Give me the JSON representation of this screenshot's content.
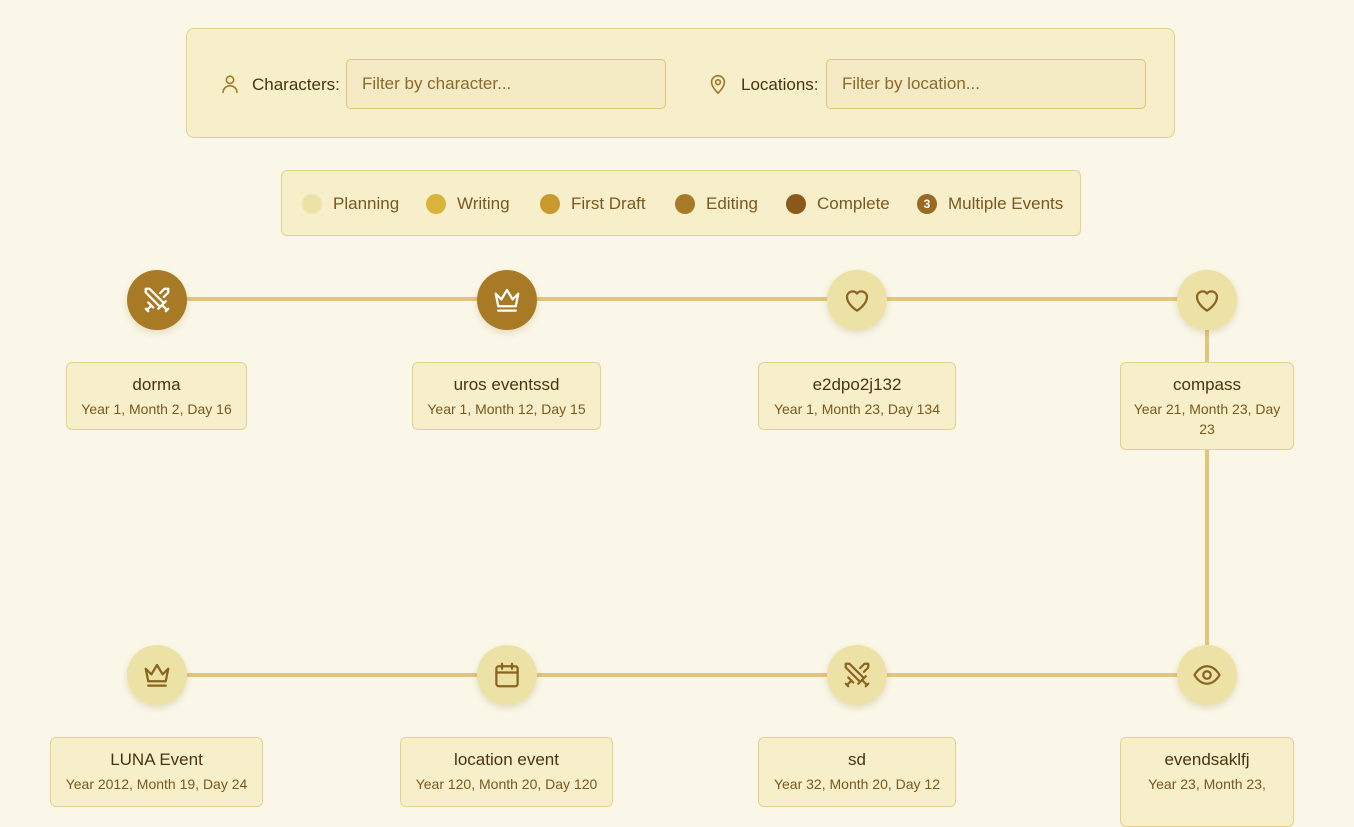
{
  "filters": {
    "characters_label": "Characters:",
    "characters_placeholder": "Filter by character...",
    "locations_label": "Locations:",
    "locations_placeholder": "Filter by location..."
  },
  "legend": {
    "items": [
      {
        "label": "Planning",
        "color": "#ede2a5"
      },
      {
        "label": "Writing",
        "color": "#d9b43a"
      },
      {
        "label": "First Draft",
        "color": "#c89a2e"
      },
      {
        "label": "Editing",
        "color": "#a97a25"
      },
      {
        "label": "Complete",
        "color": "#8a5a1c"
      }
    ],
    "multiple": {
      "count": "3",
      "label": "Multiple Events"
    }
  },
  "timeline": {
    "rows": [
      [
        {
          "title": "dorma",
          "date": "Year 1, Month 2, Day 16",
          "icon": "swords-icon",
          "status": "Editing"
        },
        {
          "title": "uros eventssd",
          "date": "Year 1, Month 12, Day 15",
          "icon": "crown-icon",
          "status": "Editing"
        },
        {
          "title": "e2dpo2j132",
          "date": "Year 1, Month 23, Day 134",
          "icon": "heart-icon",
          "status": "Planning"
        },
        {
          "title": "compass",
          "date": "Year 21, Month 23, Day 23",
          "icon": "heart-icon",
          "status": "Planning"
        }
      ],
      [
        {
          "title": "LUNA Event",
          "date": "Year 2012, Month 19, Day 24",
          "icon": "crown-icon",
          "status": "Planning"
        },
        {
          "title": "location event",
          "date": "Year 120, Month 20, Day 120",
          "icon": "calendar-icon",
          "status": "Planning"
        },
        {
          "title": "sd",
          "date": "Year 32, Month 20, Day 12",
          "icon": "swords-icon",
          "status": "Planning"
        },
        {
          "title": "evendsaklfj",
          "date": "Year 23, Month 23,",
          "icon": "eye-icon",
          "status": "Planning"
        }
      ]
    ]
  }
}
